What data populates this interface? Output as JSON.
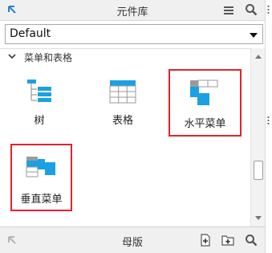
{
  "header": {
    "title": "元件库",
    "icons": [
      "collapse-arrow-icon",
      "menu-icon",
      "search-icon"
    ]
  },
  "library_select": {
    "value": "Default"
  },
  "category": {
    "label": "菜单和表格",
    "expanded": true
  },
  "widgets": [
    {
      "label": "树",
      "icon": "tree-icon",
      "highlighted": false
    },
    {
      "label": "表格",
      "icon": "table-icon",
      "highlighted": false
    },
    {
      "label": "水平菜单",
      "icon": "horizontal-menu-icon",
      "highlighted": true
    },
    {
      "label": "垂直菜单",
      "icon": "vertical-menu-icon",
      "highlighted": true
    }
  ],
  "footer": {
    "title": "母版",
    "icons": [
      "collapse-arrow-icon",
      "add-master-icon",
      "add-folder-icon",
      "search-icon"
    ]
  },
  "colors": {
    "accent_blue": "#1ba1e2",
    "highlight_red": "#e0242e",
    "panel_header": "#f0f0f0"
  }
}
